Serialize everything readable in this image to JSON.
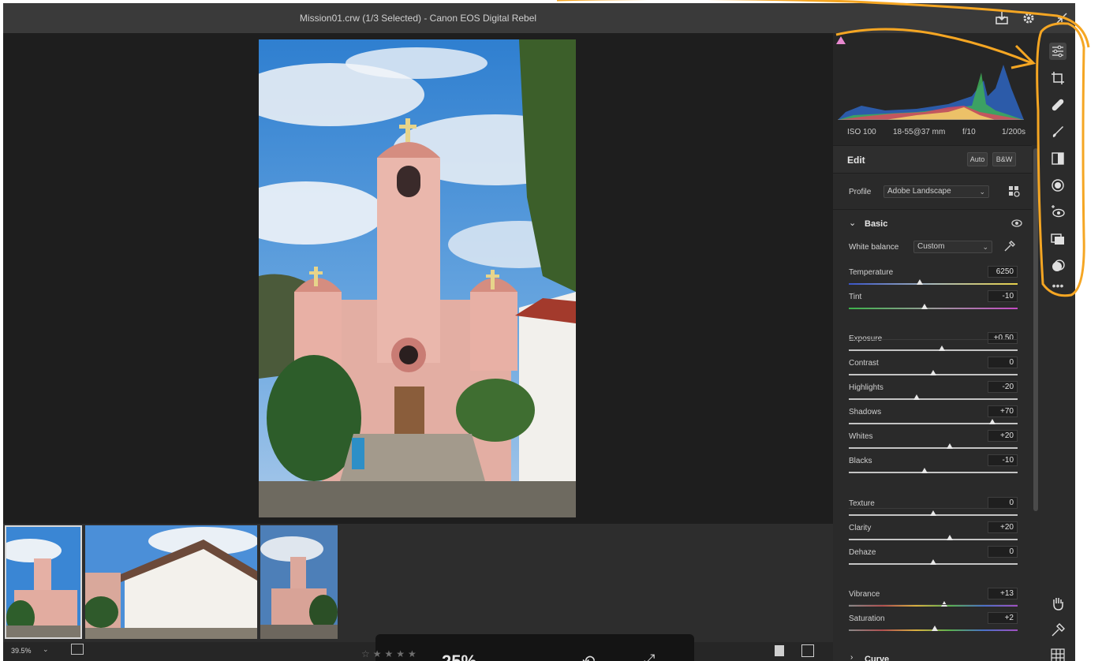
{
  "titlebar": {
    "title": "Mission01.crw (1/3 Selected)  -  Canon EOS Digital Rebel"
  },
  "exif": {
    "iso": "ISO 100",
    "lens": "18-55@37 mm",
    "aperture": "f/10",
    "shutter": "1/200s"
  },
  "edit": {
    "title": "Edit",
    "auto_label": "Auto",
    "bw_label": "B&W"
  },
  "profile": {
    "label": "Profile",
    "value": "Adobe Landscape"
  },
  "basic": {
    "title": "Basic",
    "white_balance": {
      "label": "White balance",
      "value": "Custom"
    },
    "sliders": [
      {
        "name": "Temperature",
        "value": "6250",
        "position": 0.42,
        "track": "temp"
      },
      {
        "name": "Tint",
        "value": "-10",
        "position": 0.45,
        "track": "tint"
      },
      {
        "name": "Exposure",
        "value": "+0.50",
        "position": 0.55,
        "track": "plain"
      },
      {
        "name": "Contrast",
        "value": "0",
        "position": 0.5,
        "track": "plain"
      },
      {
        "name": "Highlights",
        "value": "-20",
        "position": 0.4,
        "track": "plain"
      },
      {
        "name": "Shadows",
        "value": "+70",
        "position": 0.85,
        "track": "plain"
      },
      {
        "name": "Whites",
        "value": "+20",
        "position": 0.6,
        "track": "plain"
      },
      {
        "name": "Blacks",
        "value": "-10",
        "position": 0.45,
        "track": "plain"
      },
      {
        "name": "Texture",
        "value": "0",
        "position": 0.5,
        "track": "plain"
      },
      {
        "name": "Clarity",
        "value": "+20",
        "position": 0.6,
        "track": "plain"
      },
      {
        "name": "Dehaze",
        "value": "0",
        "position": 0.5,
        "track": "plain"
      },
      {
        "name": "Vibrance",
        "value": "+13",
        "position": 0.565,
        "track": "sat"
      },
      {
        "name": "Saturation",
        "value": "+2",
        "position": 0.51,
        "track": "sat"
      }
    ]
  },
  "curve": {
    "title": "Curve"
  },
  "bottombar": {
    "zoom": "39.5%",
    "overlay_zoom": "25%"
  },
  "colors": {
    "accent_annotation": "#f5a623",
    "panel_bg": "#2a2a2a",
    "app_bg": "#262626"
  },
  "tools": [
    "edit-sliders-icon",
    "crop-icon",
    "healing-icon",
    "brush-icon",
    "linear-gradient-icon",
    "radial-filter-icon",
    "red-eye-icon",
    "snapshots-icon",
    "presets-icon",
    "more-icon"
  ]
}
